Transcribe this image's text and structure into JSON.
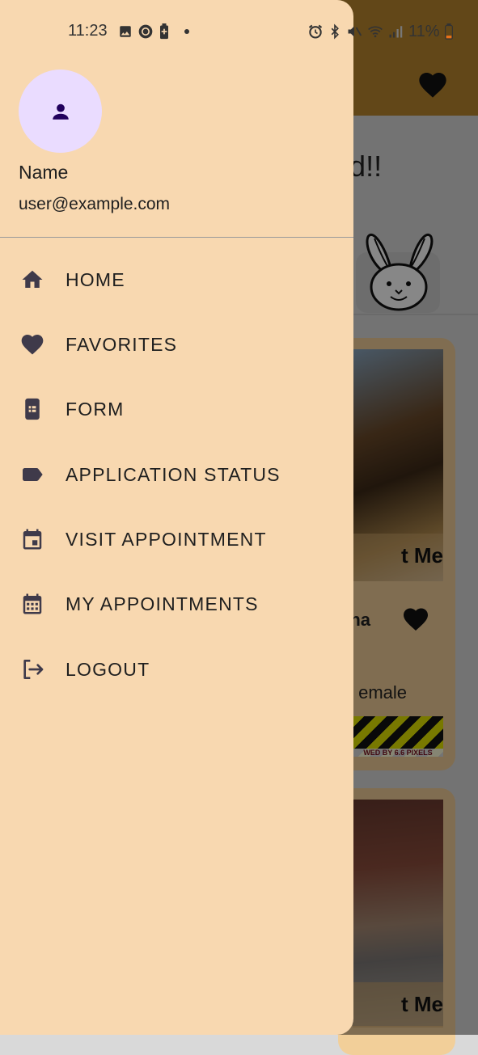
{
  "status_bar": {
    "time": "11:23",
    "battery": "11%",
    "icons_left": [
      "image-icon",
      "vpn-icon",
      "battery-saver-icon",
      "dot-icon"
    ],
    "icons_right": [
      "alarm-icon",
      "bluetooth-icon",
      "mute-icon",
      "wifi-icon",
      "signal-icon",
      "battery-icon"
    ]
  },
  "drawer": {
    "user": {
      "name": "Name",
      "email": "user@example.com",
      "avatar_icon": "person-icon"
    },
    "items": [
      {
        "label": "HOME",
        "icon": "home-icon"
      },
      {
        "label": "FAVORITES",
        "icon": "heart-icon"
      },
      {
        "label": "FORM",
        "icon": "form-icon"
      },
      {
        "label": "APPLICATION STATUS",
        "icon": "label-icon"
      },
      {
        "label": "VISIT APPOINTMENT",
        "icon": "calendar-icon"
      },
      {
        "label": "MY APPOINTMENTS",
        "icon": "calendar-month-icon"
      },
      {
        "label": "LOGOUT",
        "icon": "logout-icon"
      }
    ]
  },
  "background": {
    "title_fragment": "end!!",
    "card1": {
      "button_fragment": "t Me",
      "name_fragment": "na",
      "gender_fragment": "emale",
      "ad_text": "WED BY 6.6 PIXELS"
    },
    "card2": {
      "button_fragment": "t Me"
    }
  },
  "colors": {
    "drawer_bg": "#f8d8b0",
    "app_bar": "#b9862f",
    "avatar_bg": "#eadcff",
    "card_bg": "#f2cf99"
  }
}
